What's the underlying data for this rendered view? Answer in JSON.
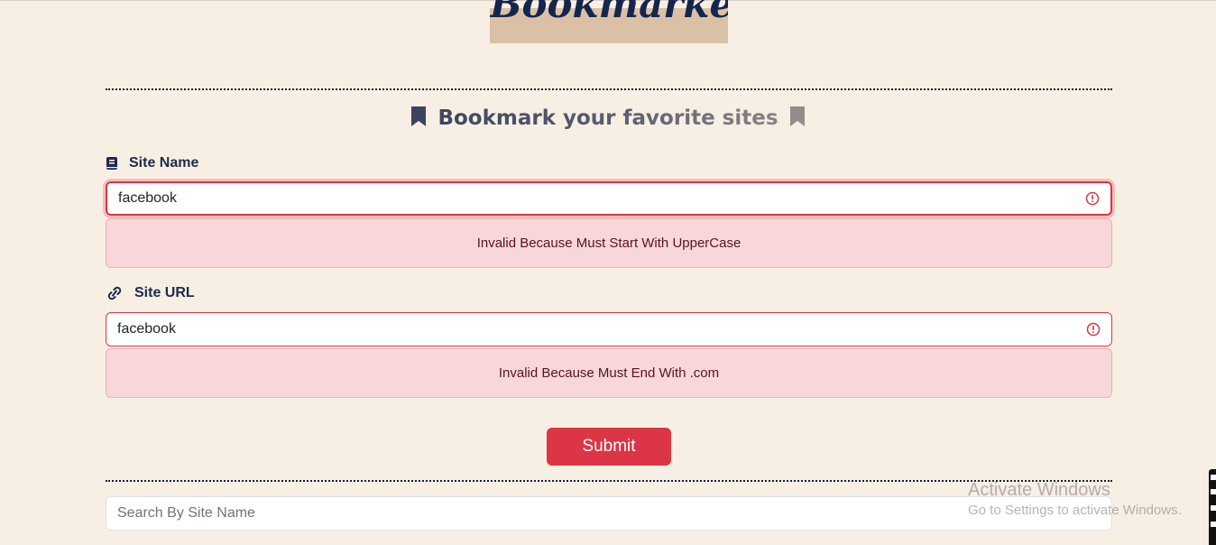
{
  "app": {
    "logo_text": "Bookmarker"
  },
  "heading": {
    "text": "Bookmark your favorite sites"
  },
  "form": {
    "site_name": {
      "label": "Site Name",
      "value": "facebook",
      "error": "Invalid Because Must Start With UpperCase"
    },
    "site_url": {
      "label": "Site URL",
      "value": "facebook",
      "error": "Invalid Because Must End With .com"
    },
    "submit_label": "Submit"
  },
  "search": {
    "placeholder": "Search By Site Name"
  },
  "watermark": {
    "line1": "Activate Windows",
    "line2": "Go to Settings to activate Windows."
  },
  "colors": {
    "background": "#f8efe4",
    "accent_navy": "#15254d",
    "danger": "#dc3545",
    "alert_bg": "#f8d7da"
  },
  "icons": [
    "bookmark-icon",
    "book-icon",
    "link-icon",
    "error-circle-icon"
  ]
}
